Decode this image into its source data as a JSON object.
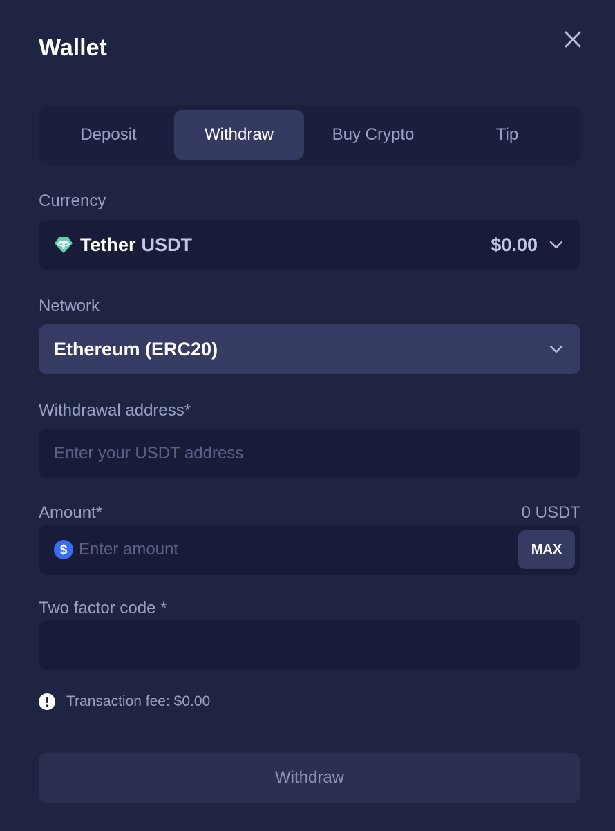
{
  "header": {
    "title": "Wallet"
  },
  "tabs": [
    {
      "label": "Deposit"
    },
    {
      "label": "Withdraw"
    },
    {
      "label": "Buy Crypto"
    },
    {
      "label": "Tip"
    }
  ],
  "currency": {
    "label": "Currency",
    "name": "Tether",
    "code": "USDT",
    "amount": "$0.00",
    "icon": "tether-icon"
  },
  "network": {
    "label": "Network",
    "value": "Ethereum (ERC20)"
  },
  "address": {
    "label": "Withdrawal address*",
    "placeholder": "Enter your USDT address",
    "value": ""
  },
  "amount": {
    "label": "Amount*",
    "balance": "0 USDT",
    "placeholder": "Enter amount",
    "max_label": "MAX",
    "icon": "dollar-icon"
  },
  "twofactor": {
    "label": "Two factor code *",
    "value": ""
  },
  "fee": {
    "text": "Transaction fee: $0.00",
    "icon": "info-icon"
  },
  "submit": {
    "label": "Withdraw"
  },
  "colors": {
    "background": "#1f2443",
    "panel": "#181c38",
    "active": "#363b64",
    "tether_green": "#26a17b",
    "dollar_blue": "#3b6cf6"
  }
}
